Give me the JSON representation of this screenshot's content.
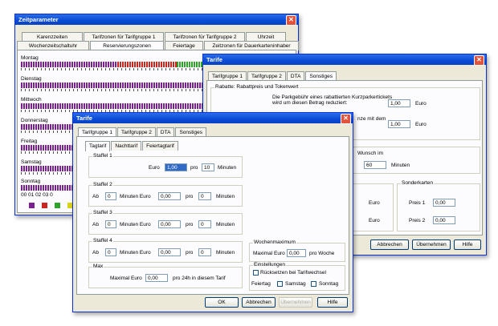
{
  "zeit": {
    "title": "Zeitparameter",
    "tabs_row1": [
      "Karenzzeiten",
      "Tarifzonen für Tarifgruppe 1",
      "Tarifzonen für Tarifgruppe 2",
      "Uhrzeit"
    ],
    "tabs_row2": [
      "Wochenzeitschaltuhr",
      "Reservierungszonen",
      "Feiertage",
      "Zeitzonen für Dauerkarteninhaber"
    ],
    "days": [
      "Montag",
      "Dienstag",
      "Mittwoch",
      "Donnerstag",
      "Freitag",
      "Samstag",
      "Sonntag"
    ],
    "hours": "00  01  02  03  0",
    "colors": {
      "purple": "#7a2190",
      "red": "#c8261f",
      "green": "#2ea52a",
      "yellow": "#d9d21c"
    }
  },
  "tarife_back": {
    "title": "Tarife",
    "tabs": [
      "Tarifgruppe 1",
      "Tarifgruppe 2",
      "DTA",
      "Sonstiges"
    ],
    "rabatte_label": "Rabatte: Rabattpreis und Tokenwert",
    "rabatte_text1": "Die Parkgebühr eines rabattierten Kurzparkertickets",
    "rabatte_text2": "wird um diesen Betrag reduziert:",
    "rabatte_value": "1,00",
    "euro": "Euro",
    "grenze_text": "nze mit dem",
    "grenze_value": "1,00",
    "wunsch_label": "Wunsch im",
    "minuten_value": "60",
    "minuten": "Minuten",
    "sonderkarten_label": "Sonderkarten",
    "preis1_label": "Preis 1",
    "preis1_value": "0,00",
    "preis2_label": "Preis 2",
    "preis2_value": "0,00",
    "buttons": {
      "abbrechen": "Abbrechen",
      "uebernehmen": "Übernehmen",
      "hilfe": "Hilfe"
    }
  },
  "tarife_front": {
    "title": "Tarife",
    "tabs": [
      "Tarifgruppe 1",
      "Tarifgruppe 2",
      "DTA",
      "Sonstiges"
    ],
    "subtabs": [
      "Tagtarif",
      "Nachttarif",
      "Feiertagtarif"
    ],
    "staffel1": {
      "label": "Staffel 1",
      "euro_label": "Euro",
      "euro_value": "1,00",
      "pro": "pro",
      "minutes_value": "10",
      "minuten": "Minuten"
    },
    "staffel2": {
      "label": "Staffel 2",
      "ab": "Ab",
      "ab_value": "0",
      "minuten_euro": "Minuten Euro",
      "euro_value": "0,00",
      "pro": "pro",
      "minutes_value": "0",
      "minuten": "Minuten"
    },
    "staffel3": {
      "label": "Staffel 3",
      "ab": "Ab",
      "ab_value": "0",
      "minuten_euro": "Minuten Euro",
      "euro_value": "0,00",
      "pro": "pro",
      "minutes_value": "0",
      "minuten": "Minuten"
    },
    "staffel4": {
      "label": "Staffel 4",
      "ab": "Ab",
      "ab_value": "0",
      "minuten_euro": "Minuten Euro",
      "euro_value": "0,00",
      "pro": "pro",
      "minutes_value": "0",
      "minuten": "Minuten"
    },
    "max": {
      "label": "Max",
      "text": "Maximal Euro",
      "value": "0,00",
      "suffix": "pro 24h in diesem Tarif"
    },
    "wochenmax": {
      "label": "Wochenmaximum",
      "text": "Maximal Euro",
      "value": "0,00",
      "suffix": "pro Woche"
    },
    "einstellungen": {
      "label": "Einstellungen",
      "rueck": "Rücksetzen bei Tarifwechsel",
      "feiertag": "Feiertag",
      "samstag": "Samstag",
      "sonntag": "Sonntag"
    },
    "buttons": {
      "ok": "OK",
      "abbrechen": "Abbrechen",
      "uebernehmen": "Übernehmen",
      "hilfe": "Hilfe"
    }
  }
}
